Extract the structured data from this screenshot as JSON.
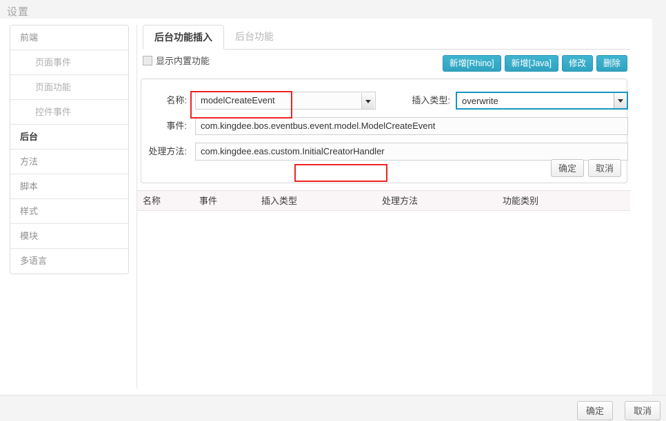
{
  "window": {
    "title": "设置"
  },
  "sidebar": {
    "items": [
      {
        "label": "前端",
        "level": "parent",
        "active": false
      },
      {
        "label": "页面事件",
        "level": "child",
        "active": false
      },
      {
        "label": "页面功能",
        "level": "child",
        "active": false
      },
      {
        "label": "控件事件",
        "level": "child",
        "active": false
      },
      {
        "label": "后台",
        "level": "parent",
        "active": true
      },
      {
        "label": "方法",
        "level": "parent",
        "active": false
      },
      {
        "label": "脚本",
        "level": "parent",
        "active": false
      },
      {
        "label": "样式",
        "level": "parent",
        "active": false
      },
      {
        "label": "模块",
        "level": "parent",
        "active": false
      },
      {
        "label": "多语言",
        "level": "parent",
        "active": false
      }
    ]
  },
  "main": {
    "tabs": [
      {
        "label": "后台功能插入",
        "active": true
      },
      {
        "label": "后台功能",
        "active": false
      }
    ],
    "checkbox": {
      "label": "显示内置功能",
      "checked": false
    },
    "toolbar": {
      "buttons": [
        {
          "label": "新增[Rhino]"
        },
        {
          "label": "新增[Java]"
        },
        {
          "label": "修改"
        },
        {
          "label": "删除"
        }
      ],
      "color": "#2fa3c0"
    },
    "form": {
      "name_label": "名称:",
      "name_value": "modelCreateEvent",
      "insert_type_label": "插入类型:",
      "insert_type_value": "overwrite",
      "event_label": "事件:",
      "event_value": "com.kingdee.bos.eventbus.event.model.ModelCreateEvent",
      "handler_label": "处理方法:",
      "handler_value": "com.kingdee.eas.custom.InitialCreatorHandler",
      "ok_label": "确定",
      "cancel_label": "取消"
    },
    "table": {
      "columns": [
        "名称",
        "事件",
        "插入类型",
        "处理方法",
        "功能类别"
      ],
      "rows": []
    }
  },
  "footer": {
    "ok_label": "确定",
    "cancel_label": "取消"
  },
  "annotations": {
    "accent_color": "#ee2222",
    "highlight_1": "modelCreateEvent",
    "highlight_2": "InitialCreatorHandler"
  }
}
